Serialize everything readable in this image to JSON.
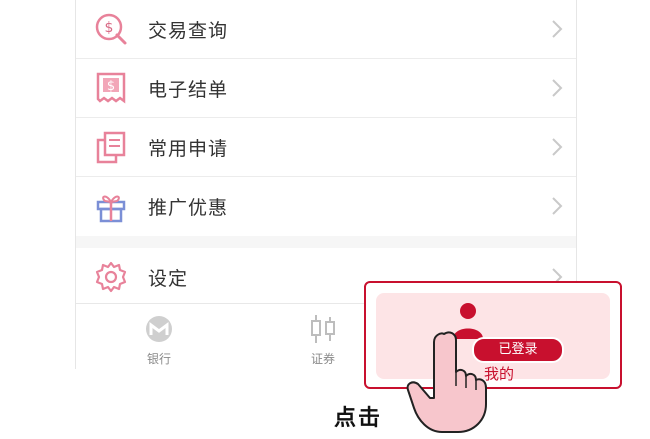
{
  "menu": {
    "items": [
      {
        "label": "交易查询",
        "icon": "search-dollar-icon"
      },
      {
        "label": "电子结单",
        "icon": "receipt-dollar-icon"
      },
      {
        "label": "常用申请",
        "icon": "documents-icon"
      },
      {
        "label": "推广优惠",
        "icon": "gift-icon"
      },
      {
        "label": "设定",
        "icon": "gear-icon"
      }
    ]
  },
  "tabbar": {
    "tabs": [
      {
        "label": "银行",
        "icon": "bank-logo-icon"
      },
      {
        "label": "证券",
        "icon": "candlestick-icon"
      }
    ]
  },
  "popup": {
    "badge_label": "已登录",
    "tab_label": "我的",
    "icon": "user-icon"
  },
  "annotation": {
    "tap_label": "点击"
  },
  "colors": {
    "accent": "#c8102e",
    "popup_bg": "#fde4e6",
    "icon_pink": "#e8829a",
    "icon_blue": "#7b8fd6"
  }
}
